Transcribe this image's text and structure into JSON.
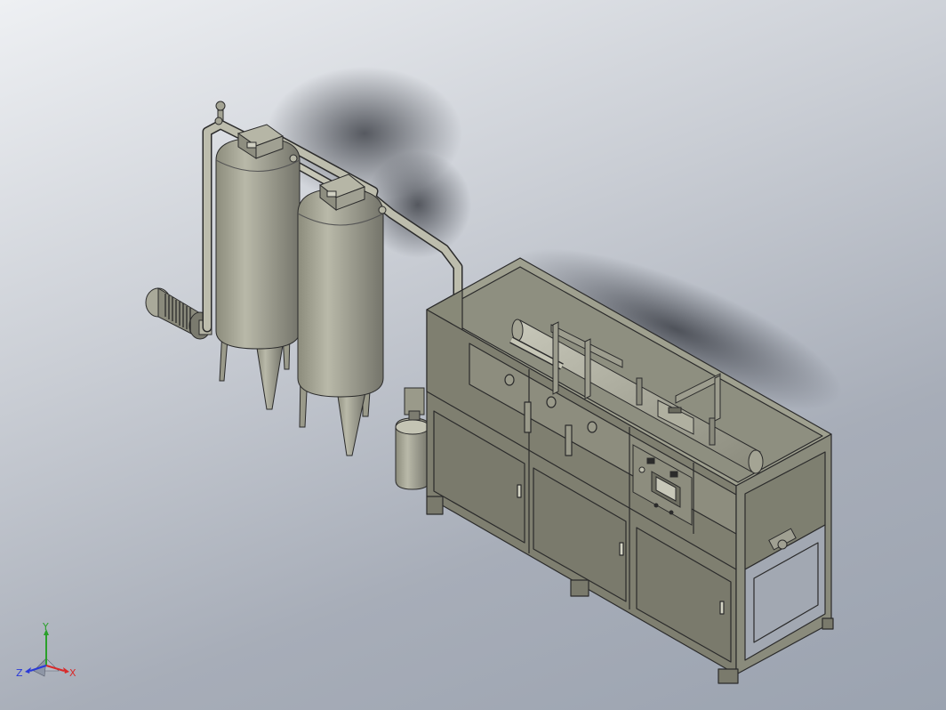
{
  "view": {
    "background_top": "#eef0f3",
    "background_bottom": "#9ba3b0",
    "model_fill": "#a7a798",
    "model_fill_dark": "#7d7d6e",
    "model_edge": "#2b2b2b"
  },
  "triad": {
    "x_label": "X",
    "y_label": "Y",
    "z_label": "Z",
    "x_color": "#d82a2a",
    "y_color": "#2aa02a",
    "z_color": "#2a3ad8"
  }
}
